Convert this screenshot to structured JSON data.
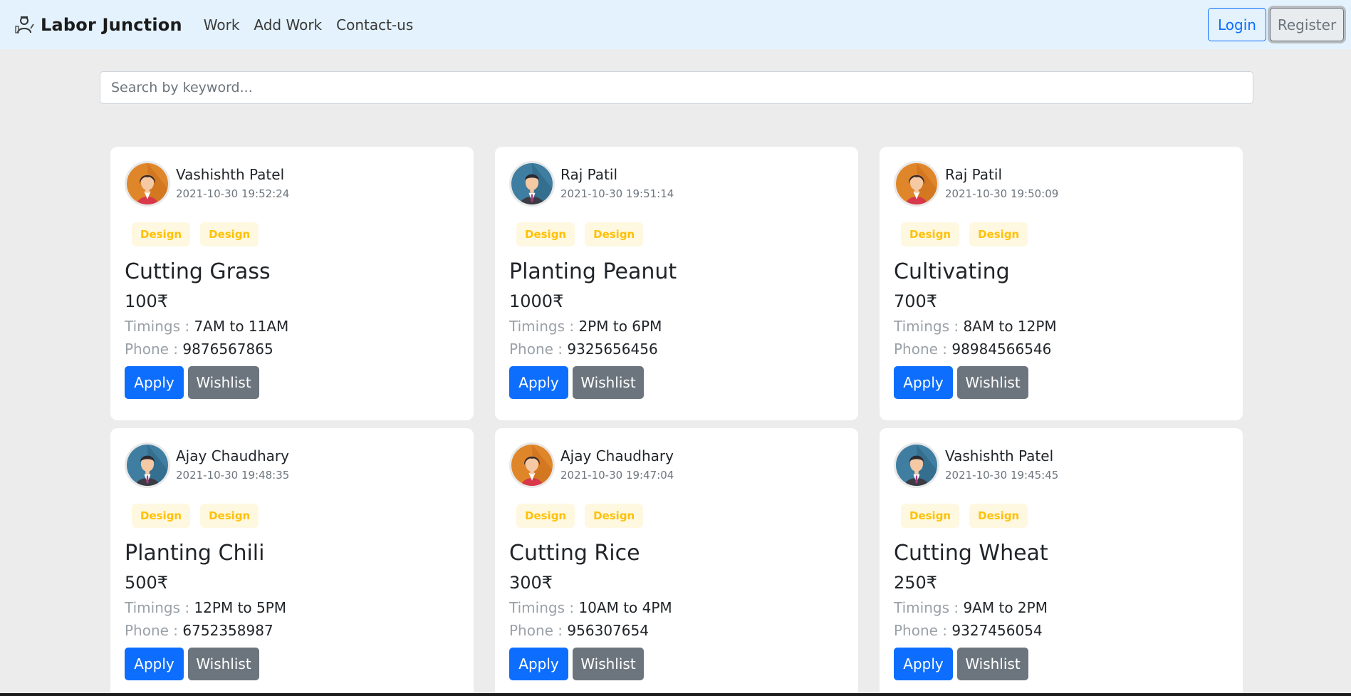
{
  "navbar": {
    "brand": "Labor Junction",
    "links": [
      "Work",
      "Add Work",
      "Contact-us"
    ],
    "login_label": "Login",
    "register_label": "Register",
    "background": "#e3f2fd"
  },
  "search": {
    "placeholder": "Search by keyword...",
    "value": ""
  },
  "cards": [
    {
      "name": "Vashishth Patel",
      "time": "2021-10-30 19:52:24",
      "avatar": "female-avatar",
      "tags": [
        "Design",
        "Design"
      ],
      "title": "Cutting Grass",
      "price": "100₹",
      "timings_label": "Timings :",
      "timings": "7AM to 11AM",
      "phone_label": "Phone :",
      "phone": "9876567865",
      "apply": "Apply",
      "wishlist": "Wishlist"
    },
    {
      "name": "Raj Patil",
      "time": "2021-10-30 19:51:14",
      "avatar": "male-avatar",
      "tags": [
        "Design",
        "Design"
      ],
      "title": "Planting Peanut",
      "price": "1000₹",
      "timings_label": "Timings :",
      "timings": "2PM to 6PM",
      "phone_label": "Phone :",
      "phone": "9325656456",
      "apply": "Apply",
      "wishlist": "Wishlist"
    },
    {
      "name": "Raj Patil",
      "time": "2021-10-30 19:50:09",
      "avatar": "female-avatar",
      "tags": [
        "Design",
        "Design"
      ],
      "title": "Cultivating",
      "price": "700₹",
      "timings_label": "Timings :",
      "timings": "8AM to 12PM",
      "phone_label": "Phone :",
      "phone": "98984566546",
      "apply": "Apply",
      "wishlist": "Wishlist"
    },
    {
      "name": "Ajay Chaudhary",
      "time": "2021-10-30 19:48:35",
      "avatar": "male-avatar",
      "tags": [
        "Design",
        "Design"
      ],
      "title": "Planting Chili",
      "price": "500₹",
      "timings_label": "Timings :",
      "timings": "12PM to 5PM",
      "phone_label": "Phone :",
      "phone": "6752358987",
      "apply": "Apply",
      "wishlist": "Wishlist"
    },
    {
      "name": "Ajay Chaudhary",
      "time": "2021-10-30 19:47:04",
      "avatar": "female-avatar",
      "tags": [
        "Design",
        "Design"
      ],
      "title": "Cutting Rice",
      "price": "300₹",
      "timings_label": "Timings :",
      "timings": "10AM to 4PM",
      "phone_label": "Phone :",
      "phone": "956307654",
      "apply": "Apply",
      "wishlist": "Wishlist"
    },
    {
      "name": "Vashishth Patel",
      "time": "2021-10-30 19:45:45",
      "avatar": "male-avatar",
      "tags": [
        "Design",
        "Design"
      ],
      "title": "Cutting Wheat",
      "price": "250₹",
      "timings_label": "Timings :",
      "timings": "9AM to 2PM",
      "phone_label": "Phone :",
      "phone": "9327456054",
      "apply": "Apply",
      "wishlist": "Wishlist"
    }
  ]
}
